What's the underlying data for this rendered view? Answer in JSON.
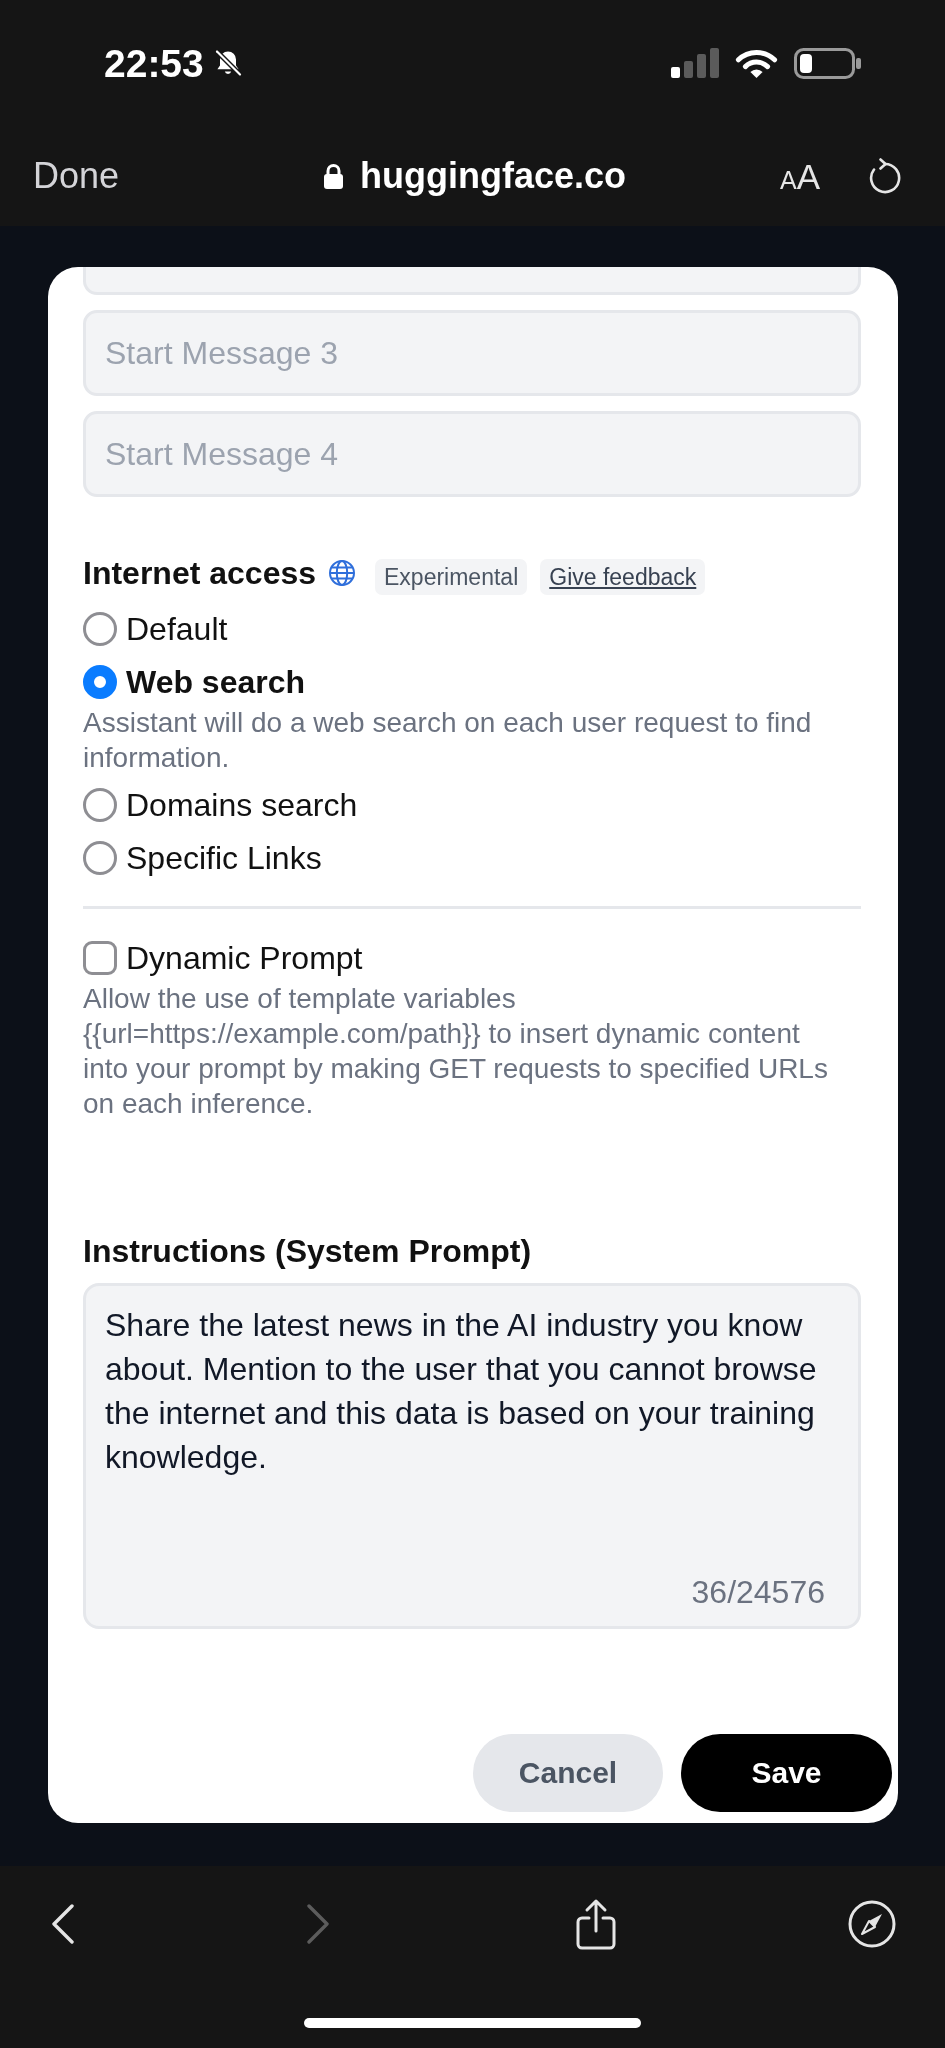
{
  "status_bar": {
    "time": "22:53"
  },
  "browser_bar": {
    "done": "Done",
    "url": "huggingface.co",
    "text_size": "AA"
  },
  "start_messages": [
    {
      "kind": "clipped"
    },
    {
      "kind": "field",
      "placeholder": "Start Message 3"
    },
    {
      "kind": "field",
      "placeholder": "Start Message 4"
    }
  ],
  "internet_access": {
    "title": "Internet access",
    "tags": [
      {
        "kind": "tag",
        "label": "Experimental"
      },
      {
        "kind": "link",
        "label": "Give feedback"
      }
    ],
    "options": [
      {
        "label": "Default",
        "selected": false
      },
      {
        "label": "Web search",
        "selected": true,
        "description": "Assistant will do a web search on each user request to find information."
      },
      {
        "label": "Domains search",
        "selected": false
      },
      {
        "label": "Specific Links",
        "selected": false
      }
    ]
  },
  "dynamic_prompt": {
    "label": "Dynamic Prompt",
    "checked": false,
    "description": "Allow the use of template variables {{url=https://example.com/path}} to insert dynamic content into your prompt by making GET requests to specified URLs on each inference."
  },
  "instructions": {
    "title": "Instructions (System Prompt)",
    "value": "Share the latest news in the AI industry you know about. Mention to the user that you cannot browse the internet and this data is based on your training knowledge.",
    "counter": "36/24576"
  },
  "actions": [
    {
      "kind": "secondary",
      "label": "Cancel"
    },
    {
      "kind": "primary",
      "label": "Save"
    }
  ],
  "toolbar": [
    {
      "kind": "back",
      "disabled": false
    },
    {
      "kind": "forward",
      "disabled": true
    },
    {
      "kind": "share",
      "disabled": false
    },
    {
      "kind": "compass",
      "disabled": false
    }
  ]
}
